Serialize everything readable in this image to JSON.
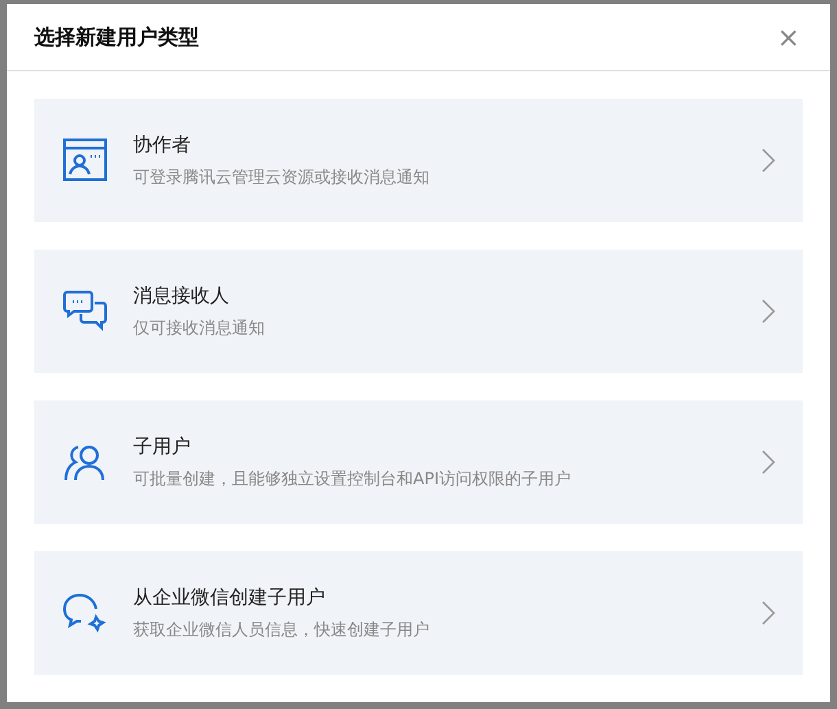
{
  "dialog": {
    "title": "选择新建用户类型",
    "close": "×",
    "options": [
      {
        "kind": "collaborator",
        "title": "协作者",
        "description": "可登录腾讯云管理云资源或接收消息通知"
      },
      {
        "kind": "message",
        "title": "消息接收人",
        "description": "仅可接收消息通知"
      },
      {
        "kind": "subuser",
        "title": "子用户",
        "description": "可批量创建，且能够独立设置控制台和API访问权限的子用户"
      },
      {
        "kind": "wecom",
        "title": "从企业微信创建子用户",
        "description": "获取企业微信人员信息，快速创建子用户"
      }
    ]
  }
}
